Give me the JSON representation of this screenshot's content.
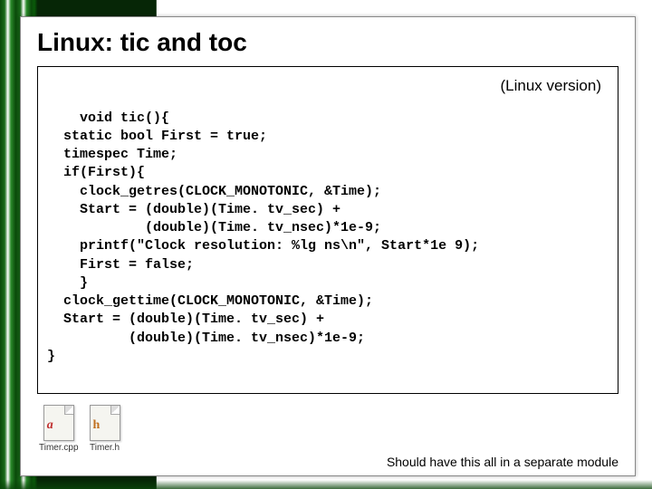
{
  "title": "Linux: tic and toc",
  "version_label": "(Linux version)",
  "code": "void tic(){\n  static bool First = true;\n  timespec Time;\n  if(First){\n    clock_getres(CLOCK_MONOTONIC, &Time);\n    Start = (double)(Time. tv_sec) +\n            (double)(Time. tv_nsec)*1e-9;\n    printf(\"Clock resolution: %lg ns\\n\", Start*1e 9);\n    First = false;\n    }\n  clock_gettime(CLOCK_MONOTONIC, &Time);\n  Start = (double)(Time. tv_sec) +\n          (double)(Time. tv_nsec)*1e-9;\n}",
  "files": [
    {
      "name": "Timer.cpp",
      "letter": "a"
    },
    {
      "name": "Timer.h",
      "letter": "h"
    }
  ],
  "footer_note": "Should have this all in a separate module"
}
